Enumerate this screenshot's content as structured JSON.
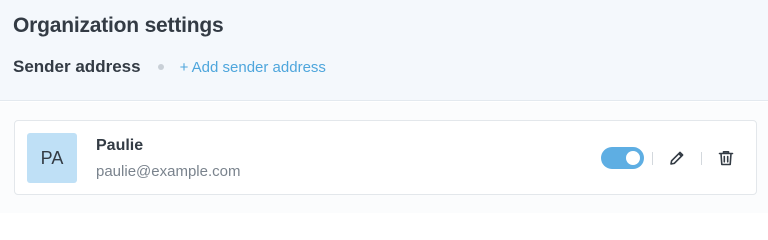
{
  "header": {
    "title": "Organization settings",
    "section_label": "Sender address",
    "add_link": "+ Add sender address"
  },
  "sender": {
    "initials": "PA",
    "name": "Paulie",
    "email": "paulie@example.com",
    "enabled": true
  },
  "colors": {
    "accent": "#4ea6dc",
    "toggle_on": "#5eaee3",
    "avatar_bg": "#bfe0f6",
    "header_bg": "#f4f8fc"
  },
  "icons": {
    "edit": "pencil-icon",
    "delete": "trash-icon"
  }
}
